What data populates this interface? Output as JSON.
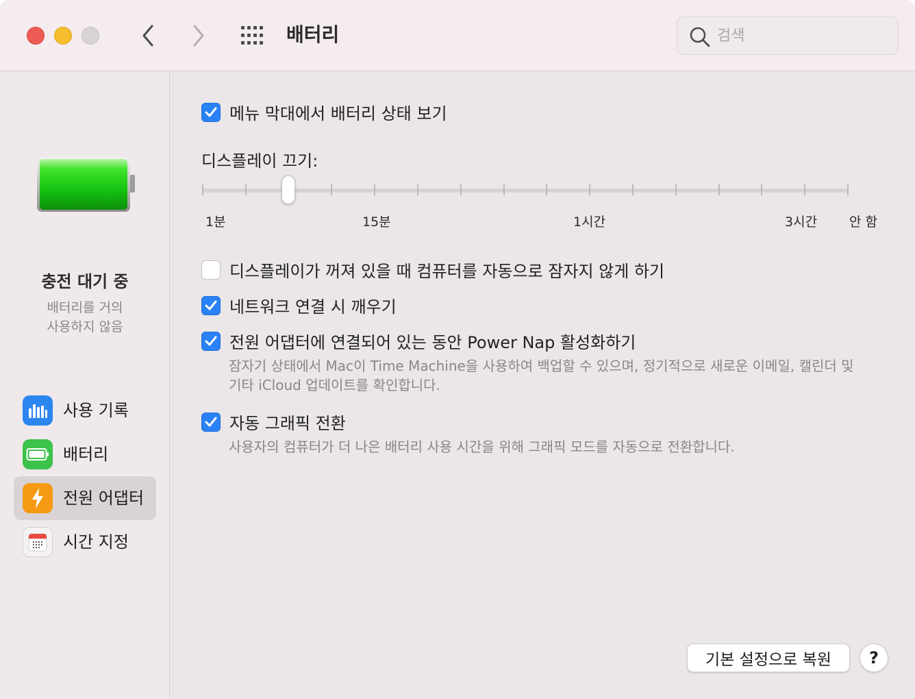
{
  "window": {
    "title": "배터리",
    "search": {
      "placeholder": "검색",
      "value": ""
    }
  },
  "sidebar": {
    "status_title": "충전 대기 중",
    "status_subtitle_line1": "배터리를 거의",
    "status_subtitle_line2": "사용하지 않음",
    "items": [
      {
        "label": "사용 기록",
        "icon": "usage-history-icon",
        "selected": false
      },
      {
        "label": "배터리",
        "icon": "battery-icon",
        "selected": false
      },
      {
        "label": "전원 어댑터",
        "icon": "power-adapter-icon",
        "selected": true
      },
      {
        "label": "시간 지정",
        "icon": "calendar-icon",
        "selected": false
      }
    ]
  },
  "main": {
    "show_in_menubar": {
      "label": "메뉴 막대에서 배터리 상태 보기",
      "checked": true
    },
    "display_off": {
      "label": "디스플레이 끄기:",
      "marks": [
        "1분",
        "15분",
        "1시간",
        "3시간",
        "안 함"
      ],
      "selected_tick_index": 2,
      "tick_count": 16
    },
    "prevent_sleep": {
      "label": "디스플레이가 꺼져 있을 때 컴퓨터를 자동으로 잠자지 않게 하기",
      "checked": false
    },
    "wake_network": {
      "label": "네트워크 연결 시 깨우기",
      "checked": true
    },
    "power_nap": {
      "label": "전원 어댑터에 연결되어 있는 동안 Power Nap 활성화하기",
      "checked": true,
      "description_line1": "잠자기 상태에서 Mac이 Time Machine을 사용하여 백업할 수 있으며, 정기적으로 새로운 이메일, 캘린더 및",
      "description_line2": "기타 iCloud 업데이트를 확인합니다."
    },
    "auto_graphics": {
      "label": "자동 그래픽 전환",
      "checked": true,
      "description": "사용자의 컴퓨터가 더 나은 배터리 사용 시간을 위해 그래픽 모드를 자동으로 전환합니다."
    }
  },
  "footer": {
    "restore_label": "기본 설정으로 복원",
    "help_label": "?"
  },
  "colors": {
    "accent": "#2a82f6",
    "battery_green": "#22c51e",
    "adapter_orange": "#f59a12"
  }
}
